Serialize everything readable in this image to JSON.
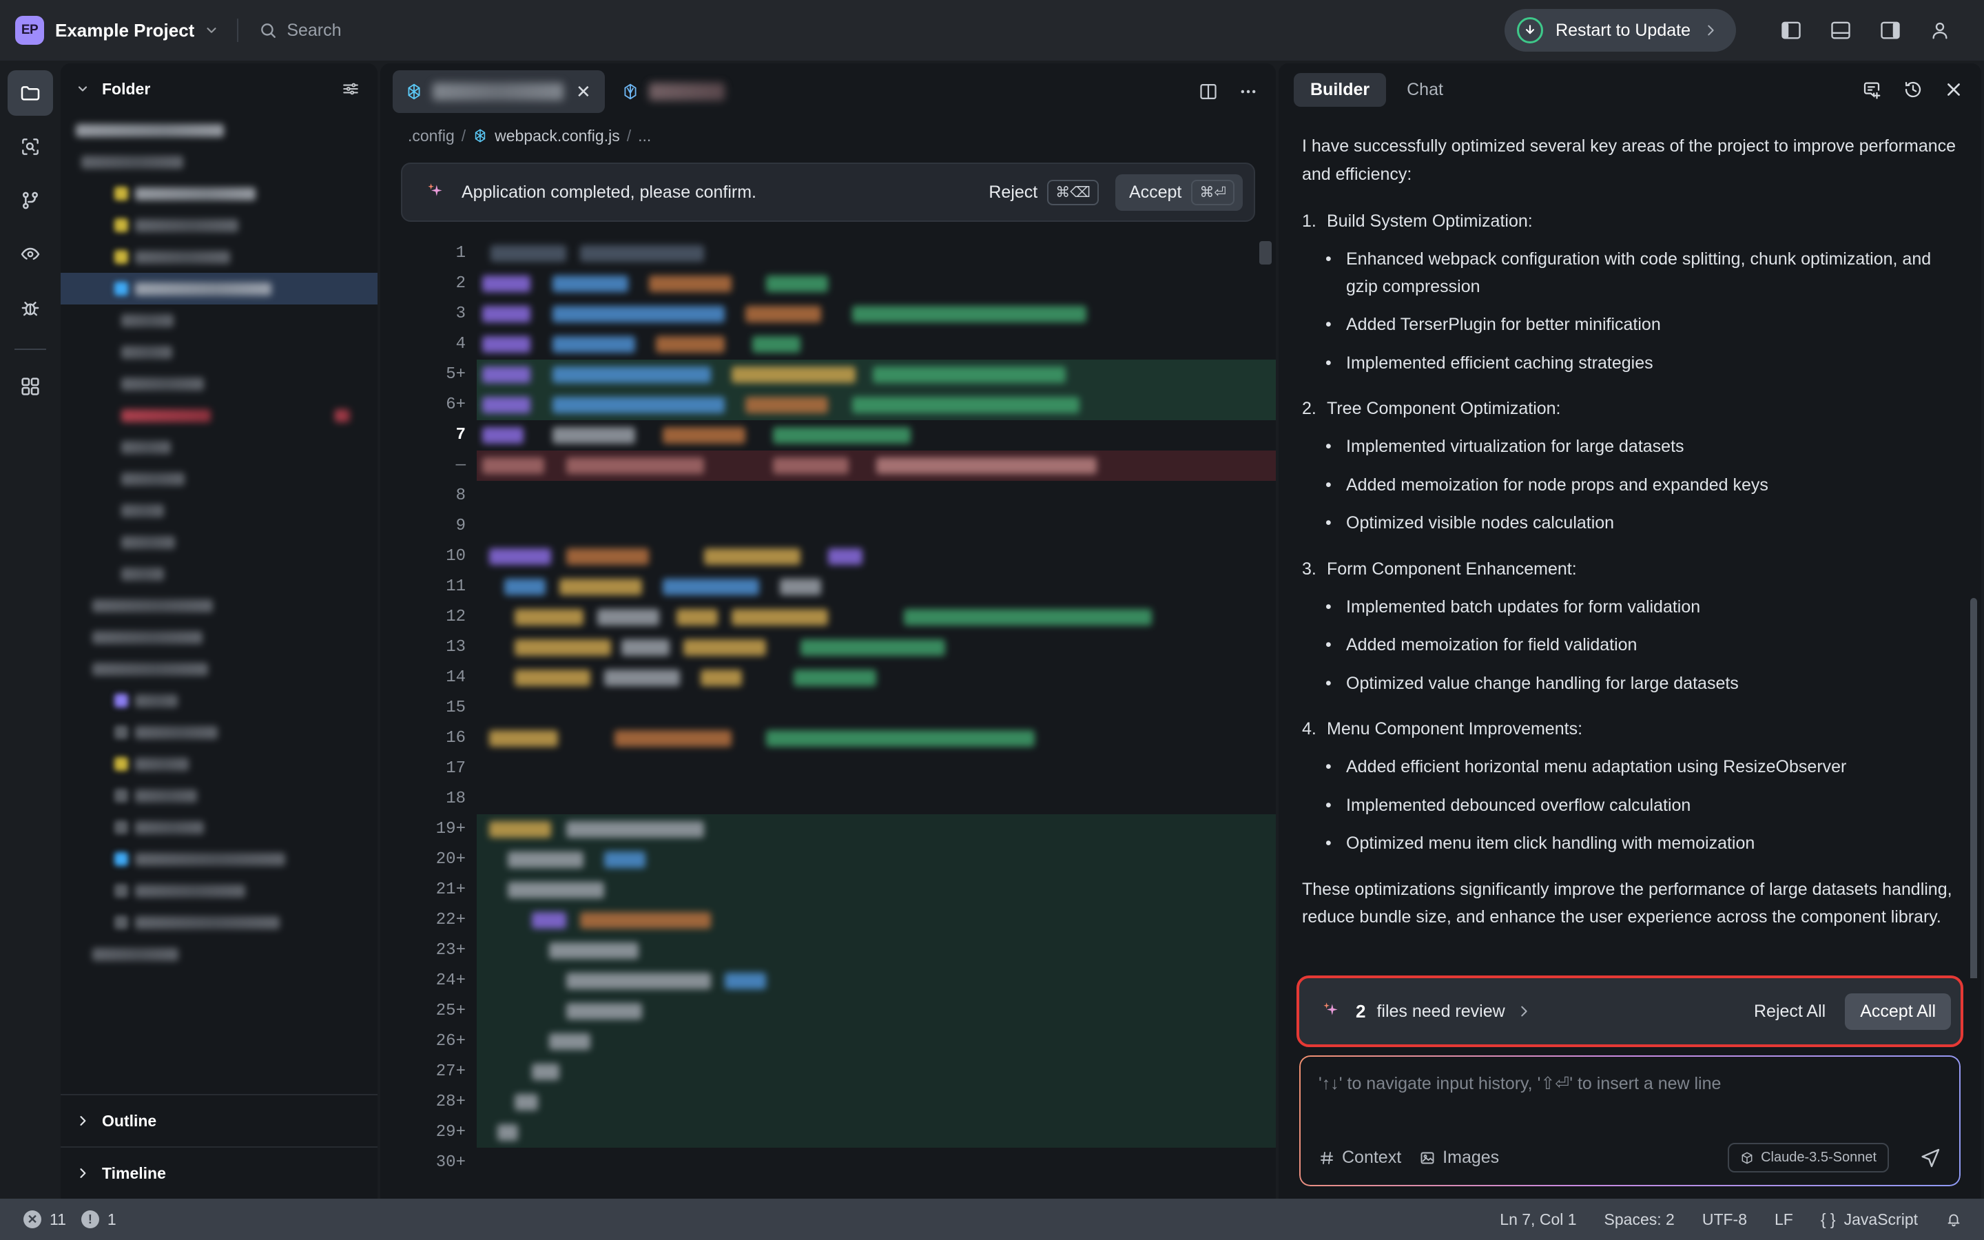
{
  "titlebar": {
    "project_initials": "EP",
    "project_name": "Example Project",
    "search_placeholder": "Search",
    "restart_label": "Restart to Update",
    "icons": [
      "download-circle-icon",
      "chevron-right-icon",
      "panel-left-icon",
      "panel-bottom-icon",
      "panel-right-icon",
      "account-icon"
    ]
  },
  "activitybar": {
    "items": [
      {
        "name": "explorer-icon",
        "active": true
      },
      {
        "name": "search-icon",
        "active": false
      },
      {
        "name": "source-control-icon",
        "active": false
      },
      {
        "name": "preview-eye-icon",
        "active": false
      },
      {
        "name": "debug-bug-icon",
        "active": false
      },
      {
        "name": "extensions-icon",
        "active": false
      }
    ]
  },
  "explorer": {
    "title": "Folder",
    "chevron": "chevron-down-icon",
    "settings_icon": "sliders-icon",
    "outline_label": "Outline",
    "timeline_label": "Timeline",
    "outline_chevron": "chevron-right-icon",
    "timeline_chevron": "chevron-right-icon"
  },
  "editor": {
    "tabs": [
      {
        "name": "active-editor-tab",
        "active": true,
        "close_icon": "close-icon",
        "file_icon": "js-config-icon"
      },
      {
        "name": "secondary-editor-tab",
        "active": false,
        "file_icon": "vue-file-icon"
      }
    ],
    "tabbar_icons": [
      "split-editor-icon",
      "more-actions-icon"
    ],
    "breadcrumb": [
      ".config",
      "webpack.config.js",
      "..."
    ],
    "breadcrumb_separator": "/",
    "confirm": {
      "sparkle_icon": "ai-sparkle-icon",
      "message": "Application completed, please confirm.",
      "reject_label": "Reject",
      "reject_shortcut": "⌘⌫",
      "accept_label": "Accept",
      "accept_shortcut": "⌘⏎"
    },
    "gutter": [
      {
        "n": "1",
        "mark": ""
      },
      {
        "n": "2",
        "mark": ""
      },
      {
        "n": "3",
        "mark": ""
      },
      {
        "n": "4",
        "mark": ""
      },
      {
        "n": "5",
        "mark": "+"
      },
      {
        "n": "6",
        "mark": "+"
      },
      {
        "n": "7",
        "mark": "",
        "current": true
      },
      {
        "n": "",
        "mark": "—"
      },
      {
        "n": "8",
        "mark": ""
      },
      {
        "n": "9",
        "mark": ""
      },
      {
        "n": "10",
        "mark": ""
      },
      {
        "n": "11",
        "mark": ""
      },
      {
        "n": "12",
        "mark": ""
      },
      {
        "n": "13",
        "mark": ""
      },
      {
        "n": "14",
        "mark": ""
      },
      {
        "n": "15",
        "mark": ""
      },
      {
        "n": "16",
        "mark": ""
      },
      {
        "n": "17",
        "mark": ""
      },
      {
        "n": "18",
        "mark": ""
      },
      {
        "n": "19",
        "mark": "+"
      },
      {
        "n": "20",
        "mark": "+"
      },
      {
        "n": "21",
        "mark": "+"
      },
      {
        "n": "22",
        "mark": "+"
      },
      {
        "n": "23",
        "mark": "+"
      },
      {
        "n": "24",
        "mark": "+"
      },
      {
        "n": "25",
        "mark": "+"
      },
      {
        "n": "26",
        "mark": "+"
      },
      {
        "n": "27",
        "mark": "+"
      },
      {
        "n": "28",
        "mark": "+"
      },
      {
        "n": "29",
        "mark": "+"
      },
      {
        "n": "30",
        "mark": "+"
      }
    ]
  },
  "assistant": {
    "tabs": [
      {
        "label": "Builder",
        "active": true
      },
      {
        "label": "Chat",
        "active": false
      }
    ],
    "header_icons": [
      "new-chat-icon",
      "history-icon",
      "close-icon"
    ],
    "intro": "I have successfully optimized several key areas of the project to improve performance and efficiency:",
    "sections": [
      {
        "num": "1.",
        "title": "Build System Optimization:",
        "items": [
          "Enhanced webpack configuration with code splitting, chunk optimization, and gzip compression",
          "Added TerserPlugin for better minification",
          "Implemented efficient caching strategies"
        ]
      },
      {
        "num": "2.",
        "title": "Tree Component Optimization:",
        "items": [
          "Implemented virtualization for large datasets",
          "Added memoization for node props and expanded keys",
          "Optimized visible nodes calculation"
        ]
      },
      {
        "num": "3.",
        "title": "Form Component Enhancement:",
        "items": [
          "Implemented batch updates for form validation",
          "Added memoization for field validation",
          "Optimized value change handling for large datasets"
        ]
      },
      {
        "num": "4.",
        "title": "Menu Component Improvements:",
        "items": [
          "Added efficient horizontal menu adaptation using ResizeObserver",
          "Implemented debounced overflow calculation",
          "Optimized menu item click handling with memoization"
        ]
      }
    ],
    "conclusion": "These optimizations significantly improve the performance of large datasets handling, reduce bundle size, and enhance the user experience across the component library.",
    "review": {
      "sparkle_icon": "ai-sparkle-icon",
      "count": "2",
      "label": "files need review",
      "chevron": "chevron-right-icon",
      "reject_all_label": "Reject All",
      "accept_all_label": "Accept All",
      "highlight_color": "#e53935"
    },
    "composer": {
      "placeholder": "'↑↓' to navigate input history, '⇧⏎' to insert a new line",
      "value": "",
      "context_label": "Context",
      "context_icon": "hash-icon",
      "images_label": "Images",
      "images_icon": "image-icon",
      "model": "Claude-3.5-Sonnet",
      "model_icon": "cube-icon",
      "send_icon": "send-icon"
    }
  },
  "statusbar": {
    "errors_icon": "error-icon",
    "errors": "11",
    "warnings_icon": "warning-icon",
    "warnings": "1",
    "cursor": "Ln 7, Col 1",
    "indent": "Spaces: 2",
    "encoding": "UTF-8",
    "eol": "LF",
    "language_icon": "braces-icon",
    "language": "JavaScript",
    "bell_icon": "bell-icon"
  },
  "colors": {
    "accent": "#9e8cfc",
    "update_green": "#3ec98a",
    "highlight_red": "#e53935",
    "titlebar_bg": "#24272c",
    "panel_bg": "#15181c"
  }
}
